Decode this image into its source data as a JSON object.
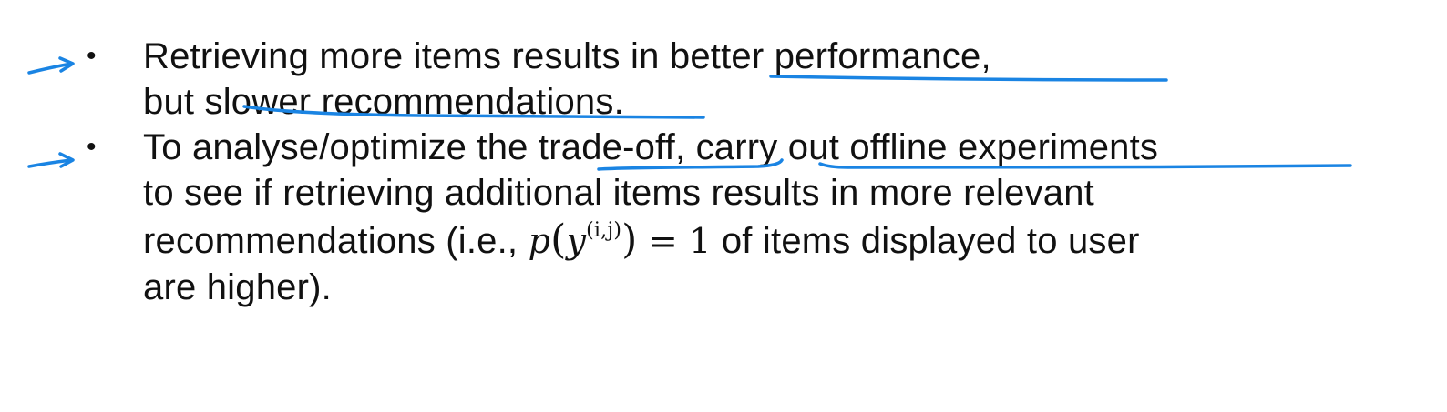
{
  "bullets": [
    {
      "lines": [
        [
          "Retrieving more items results in ",
          "better performance,"
        ],
        [
          " but s",
          "lower recommendations",
          "."
        ]
      ]
    },
    {
      "lines": [
        [
          "To analyse/optimize the ",
          "trade-off",
          ", ",
          "carry out offline experiments"
        ],
        [
          "to see if retrieving additional items results in more relevant"
        ],
        [
          "recommendations (i.e., ",
          " of items displayed to user"
        ],
        [
          "are higher)."
        ]
      ]
    }
  ],
  "math": {
    "p": "p",
    "y": "y",
    "superscript": "(i,j)",
    "lparen": "(",
    "rparen": ")",
    "equals": " = 1"
  },
  "bullet_symbol": "•",
  "annotation_color": "#1a84e3",
  "text_color": "#111111"
}
